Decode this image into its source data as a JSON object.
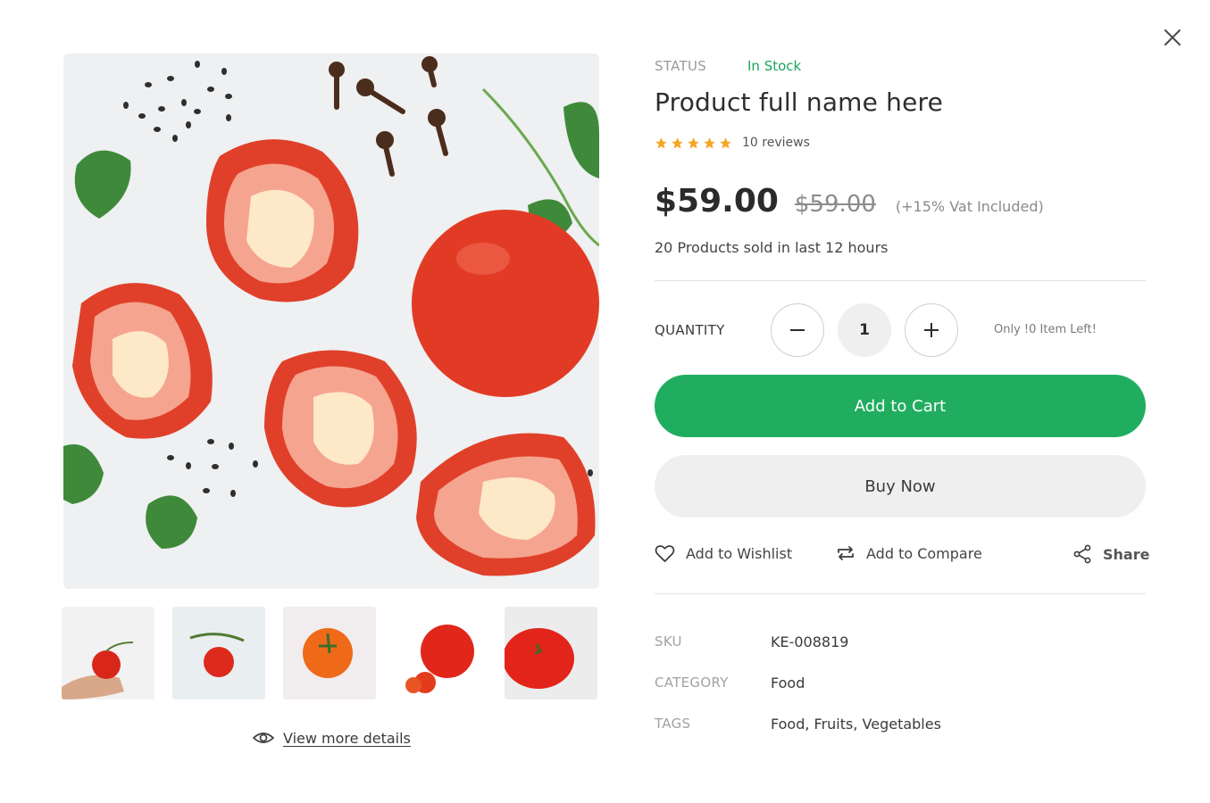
{
  "close": {
    "icon": "close-icon"
  },
  "product": {
    "status_label": "STATUS",
    "status_value": "In Stock",
    "title": "Product full name here",
    "rating_stars": 5,
    "reviews": "10 reviews",
    "price": "$59.00",
    "old_price": "$59.00",
    "vat": "(+15% Vat Included)",
    "sold_text": "20 Products sold in last 12 hours"
  },
  "quantity": {
    "label": "QUANTITY",
    "value": "1",
    "note": "Only !0 Item Left!"
  },
  "buttons": {
    "add_to_cart": "Add to Cart",
    "buy_now": "Buy Now"
  },
  "actions": {
    "wishlist": "Add to Wishlist",
    "compare": "Add to Compare",
    "share": "Share"
  },
  "meta": {
    "sku_label": "SKU",
    "sku_value": "KE-008819",
    "category_label": "CATEGORY",
    "category_value": "Food",
    "tags_label": "TAGS",
    "tags_value": "Food, Fruits, Vegetables"
  },
  "gallery": {
    "view_more": "View more details",
    "thumbnail_count": 5
  },
  "colors": {
    "accent": "#20ad5f",
    "in_stock": "#18a55a",
    "star": "#f5a623",
    "tomato": "#e8412c"
  }
}
